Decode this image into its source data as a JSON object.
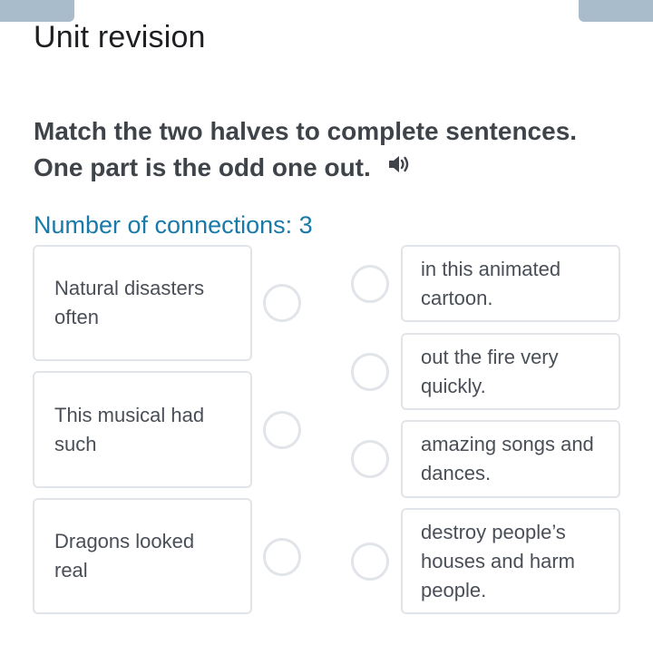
{
  "header": {
    "title": "Unit revision"
  },
  "exercise": {
    "instruction": "Match the two halves to complete sentences. One part is the odd one out.",
    "connections_label": "Number of connections: 3",
    "left_items": [
      {
        "text": "Natural disasters often"
      },
      {
        "text": "This musical had such"
      },
      {
        "text": "Dragons looked real"
      }
    ],
    "right_items": [
      {
        "text": "in this animated cartoon."
      },
      {
        "text": "out the fire very quickly."
      },
      {
        "text": "amazing songs and dances."
      },
      {
        "text": "destroy people’s houses and harm people."
      }
    ]
  },
  "icons": {
    "audio": "speaker-icon"
  },
  "colors": {
    "accent": "#1979a8",
    "border": "#e1e4e8",
    "top_tab": "#a9bccb"
  }
}
